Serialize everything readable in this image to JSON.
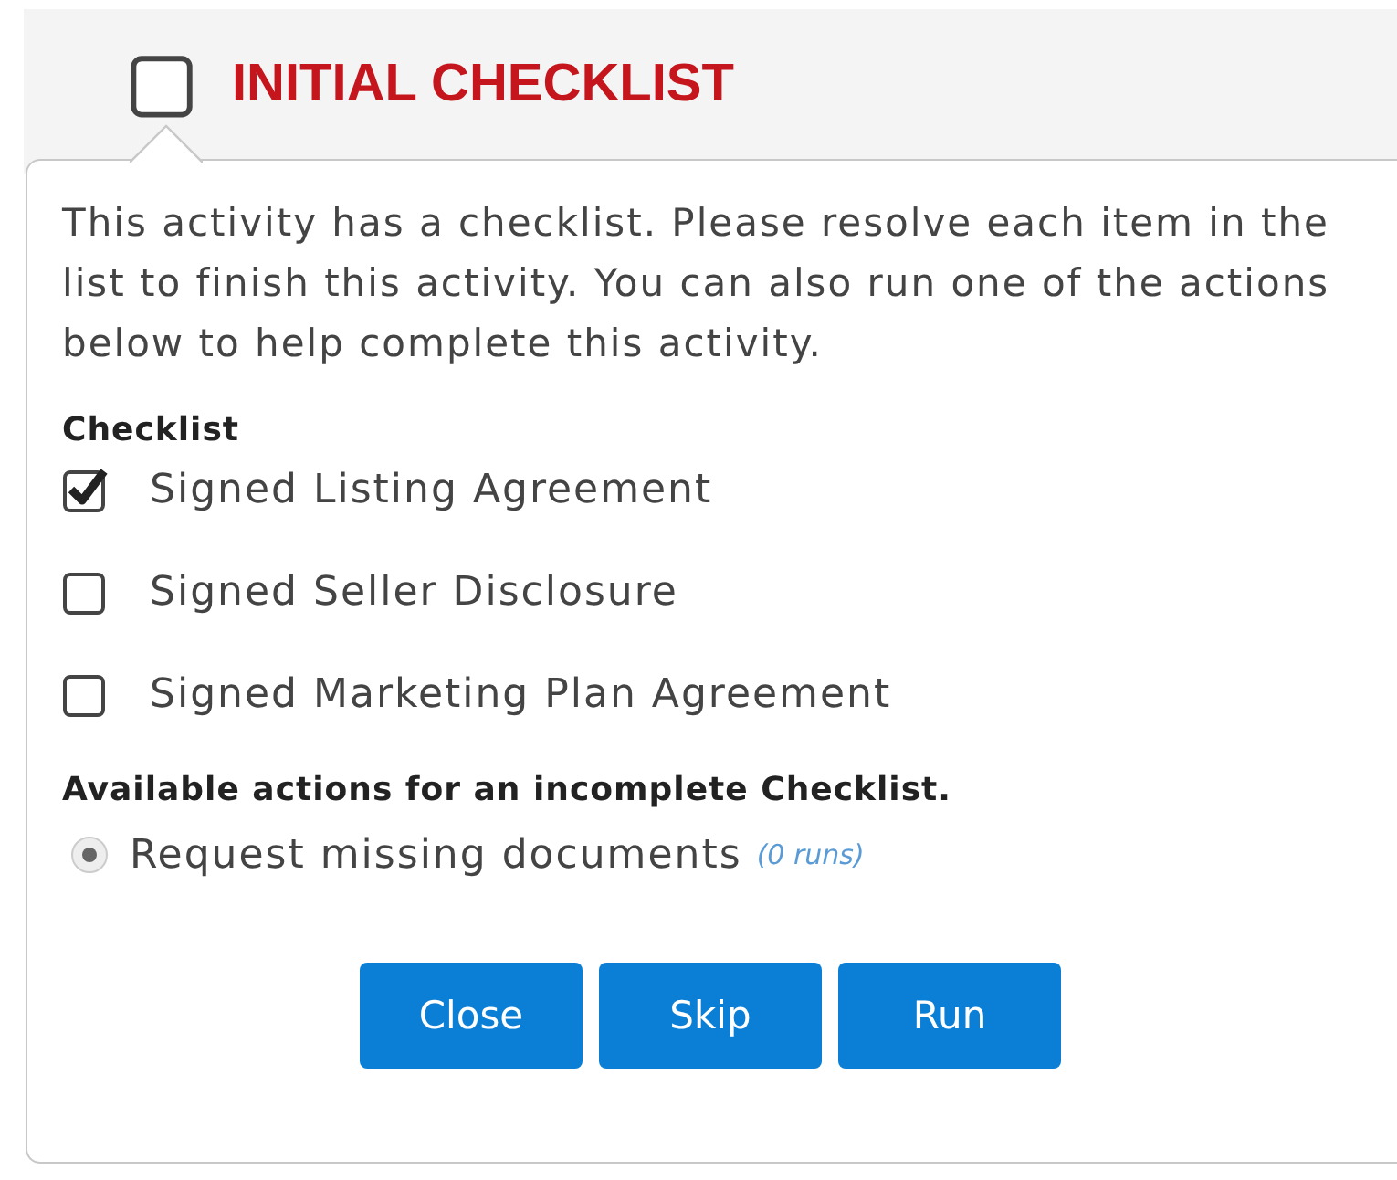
{
  "activity": {
    "title": "INITIAL CHECKLIST",
    "checked": false
  },
  "popover": {
    "message": "This activity has a checklist. Please resolve each item in the list to finish this activity. You can also run one of the actions below to help complete this activity.",
    "checklist_heading": "Checklist",
    "checklist": [
      {
        "label": "Signed Listing Agreement",
        "checked": true
      },
      {
        "label": "Signed Seller Disclosure",
        "checked": false
      },
      {
        "label": "Signed Marketing Plan Agreement",
        "checked": false
      }
    ],
    "actions_heading": "Available actions for an incomplete Checklist.",
    "actions": [
      {
        "label": "Request missing documents",
        "runs": "(0 runs)",
        "selected": true
      }
    ],
    "buttons": [
      "Close",
      "Skip",
      "Run"
    ]
  }
}
